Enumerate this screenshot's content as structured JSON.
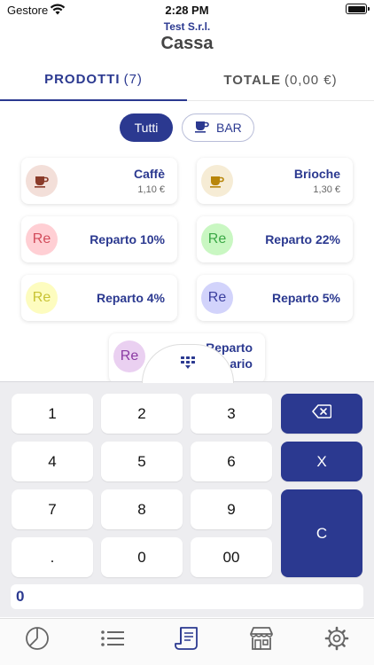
{
  "status": {
    "carrier": "Gestore",
    "time": "2:28 PM"
  },
  "header": {
    "company": "Test S.r.l.",
    "title": "Cassa"
  },
  "tabs": [
    {
      "label": "PRODOTTI",
      "count": "(7)",
      "active": true
    },
    {
      "label": "TOTALE",
      "count": "(0,00 €)",
      "active": false
    }
  ],
  "filters": [
    {
      "label": "Tutti",
      "selected": true
    },
    {
      "label": "BAR",
      "icon": "coffee-cup-icon",
      "selected": false
    }
  ],
  "products": [
    {
      "name": "Caffè",
      "price": "1,10 €",
      "icon": "coffee-cup-icon",
      "color": "#f3dfd9"
    },
    {
      "name": "Brioche",
      "price": "1,30 €",
      "icon": "coffee-cup-icon",
      "color": "#f6ecd5"
    },
    {
      "name": "Reparto 10%",
      "avatar": "Re",
      "color": "#ffcfd4",
      "text_color": "#d24b5a"
    },
    {
      "name": "Reparto 22%",
      "avatar": "Re",
      "color": "#c9f7c2",
      "text_color": "#3aa845"
    },
    {
      "name": "Reparto 4%",
      "avatar": "Re",
      "color": "#fdfcbf",
      "text_color": "#c8c334"
    },
    {
      "name": "Reparto 5%",
      "avatar": "Re",
      "color": "#d2d3fb",
      "text_color": "#3b3f9e"
    },
    {
      "name": "Reparto",
      "name2": "ario",
      "avatar": "Re",
      "color": "#ead0f1",
      "text_color": "#8b3aa3"
    }
  ],
  "keypad": {
    "keys": [
      "1",
      "2",
      "3",
      "4",
      "5",
      "6",
      "7",
      "8",
      "9",
      ".",
      "0",
      "00"
    ],
    "multiply": "X",
    "clear": "C",
    "display": "0"
  },
  "nav": [
    "dashboard-icon",
    "list-icon",
    "receipt-icon",
    "store-icon",
    "settings-icon"
  ],
  "colors": {
    "accent": "#2b3990",
    "keypad_bg": "#ededf0"
  }
}
